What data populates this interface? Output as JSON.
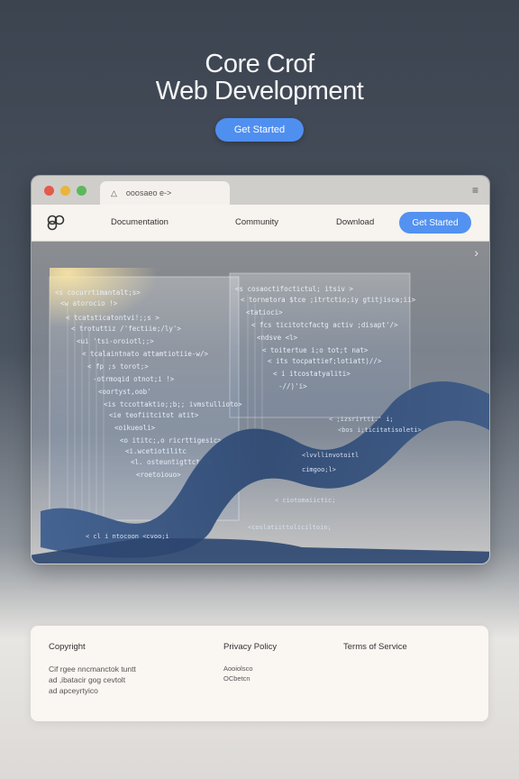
{
  "hero": {
    "title_line1": "Core Crof",
    "title_line2": "Web Development",
    "cta": "Get Started"
  },
  "browser": {
    "tab_title": "ooosaeo e->",
    "nav": {
      "documentation": "Documentation",
      "community": "Community",
      "download": "Download",
      "cta": "Get Started"
    }
  },
  "footer": {
    "col1_title": "Copyright",
    "col1_lines": [
      "Cif rgee nncmanctok tuntt",
      "ad ,ibatacir gog  cevtolt",
      "ad apceyrtyico"
    ],
    "col2_title": "Privacy Policy",
    "col2_lines": [
      "Aooiolsco",
      "OCbetcn"
    ],
    "col3_title": "Terms of Service"
  },
  "colors": {
    "accent": "#4f8ff0",
    "background_top": "#3c4450",
    "footer_bg": "#faf6f1"
  },
  "icons": [
    "logo-icon",
    "menu-icon",
    "chevron-right-icon",
    "warning-icon"
  ]
}
